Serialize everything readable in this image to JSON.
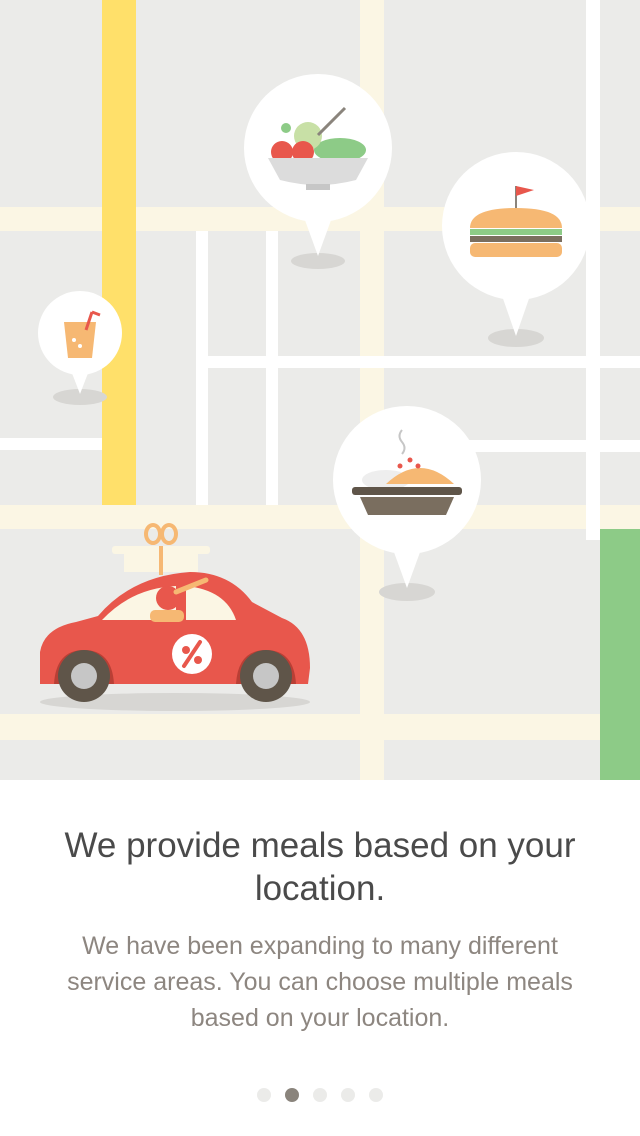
{
  "onboarding": {
    "headline": "We provide meals based on your location.",
    "body": "We have been expanding to many different service areas. You can choose multiple meals based on your location."
  },
  "pager": {
    "total": 5,
    "active_index": 1
  },
  "map": {
    "pins": [
      "salad-icon",
      "sandwich-icon",
      "juice-icon",
      "pie-icon"
    ],
    "vehicle": "delivery-car",
    "colors": {
      "background": "#ebebe9",
      "road": "#fbf6e4",
      "highway": "#ffe06a",
      "park": "#8dcb87",
      "car": "#e8574c"
    }
  }
}
